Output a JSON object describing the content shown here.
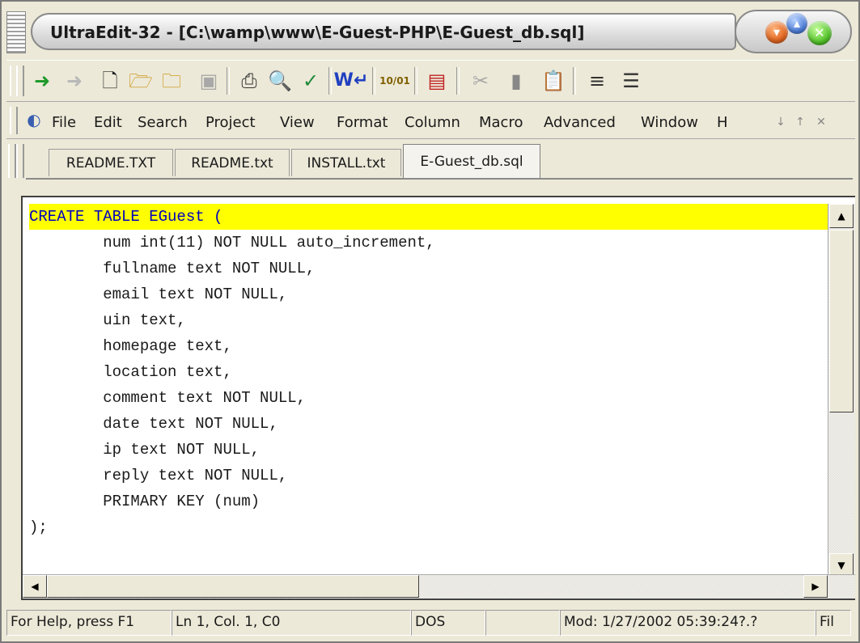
{
  "window": {
    "title": "UltraEdit-32 - [C:\\wamp\\www\\E-Guest-PHP\\E-Guest_db.sql]",
    "control_icons": [
      "minimize-icon",
      "maximize-icon",
      "close-icon"
    ]
  },
  "toolbar": {
    "icons": [
      "back-arrow-icon",
      "forward-arrow-icon",
      "new-file-icon",
      "open-file-icon",
      "close-file-icon",
      "save-icon",
      "print-icon",
      "print-preview-icon",
      "spell-check-icon",
      "word-wrap-icon",
      "hex-edit-icon",
      "column-mode-icon",
      "cut-icon",
      "copy-icon",
      "paste-icon",
      "align-left-icon",
      "justify-icon"
    ]
  },
  "menu": {
    "icon": "ultraedit-logo-icon",
    "items": [
      "File",
      "Edit",
      "Search",
      "Project",
      "View",
      "Format",
      "Column",
      "Macro",
      "Advanced",
      "Window",
      "H"
    ]
  },
  "tabs": [
    "README.TXT",
    "README.txt",
    "INSTALL.txt",
    "E-Guest_db.sql"
  ],
  "active_tab": "E-Guest_db.sql",
  "editor": {
    "lines": [
      "CREATE TABLE EGuest (",
      "        num int(11) NOT NULL auto_increment,",
      "        fullname text NOT NULL,",
      "        email text NOT NULL,",
      "        uin text,",
      "        homepage text,",
      "        location text,",
      "        comment text NOT NULL,",
      "        date text NOT NULL,",
      "        ip text NOT NULL,",
      "        reply text NOT NULL,",
      "        PRIMARY KEY (num)",
      ");"
    ],
    "highlight_color": "#ffff00",
    "highlight_text_color": "#0000c0"
  },
  "status": {
    "help": "For Help, press F1",
    "position": "Ln 1, Col. 1, C0",
    "format": "DOS",
    "empty": "",
    "modified": "Mod: 1/27/2002 05:39:24?.?",
    "file": "Fil"
  }
}
